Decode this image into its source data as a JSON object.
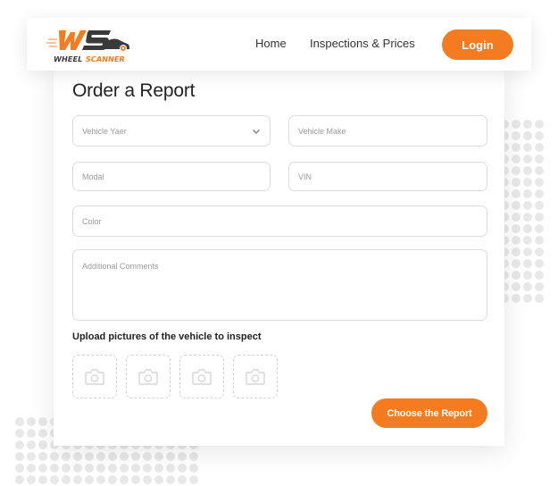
{
  "brand": {
    "logo_monogram": "WS",
    "logo_word1": "WHEEL",
    "logo_word2": "SCANNER",
    "accent_color": "#f47b20",
    "dark_color": "#3a3a3a"
  },
  "nav": {
    "items": [
      {
        "label": "Home"
      },
      {
        "label": "Inspections & Prices"
      }
    ],
    "login_label": "Login"
  },
  "form": {
    "title": "Order a Report",
    "fields": {
      "vehicle_year": {
        "placeholder": "Vehicle Yaer",
        "value": "",
        "icon": "chevron-down-icon"
      },
      "vehicle_make": {
        "placeholder": "Vehicle Make",
        "value": ""
      },
      "model": {
        "placeholder": "Modal",
        "value": ""
      },
      "vin": {
        "placeholder": "VIN",
        "value": ""
      },
      "color": {
        "placeholder": "Color",
        "value": ""
      },
      "comments": {
        "placeholder": "Additional Comments",
        "value": ""
      }
    },
    "upload_label": "Upload pictures of the vehicle to inspect",
    "upload_slots": [
      {
        "icon": "camera-icon"
      },
      {
        "icon": "camera-icon"
      },
      {
        "icon": "camera-icon"
      },
      {
        "icon": "camera-icon"
      }
    ],
    "submit_label": "Choose the Report"
  }
}
